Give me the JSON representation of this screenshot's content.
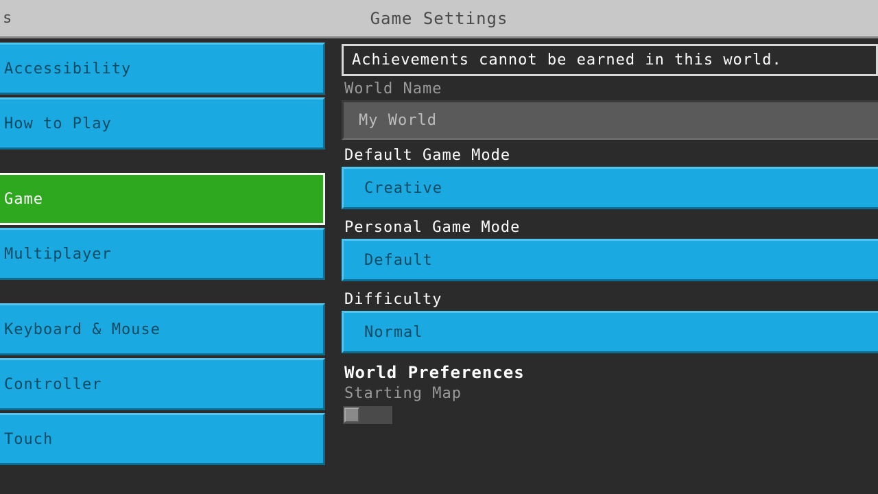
{
  "header": {
    "left_truncated": "s",
    "title": "Game Settings"
  },
  "sidebar": {
    "groups": [
      {
        "items": [
          {
            "label": "Accessibility",
            "active": false,
            "visible_text": "cessibility"
          },
          {
            "label": "How to Play",
            "active": false,
            "visible_text": "w to Play"
          }
        ]
      },
      {
        "items": [
          {
            "label": "Game",
            "active": true,
            "visible_text": "me"
          },
          {
            "label": "Multiplayer",
            "active": false,
            "visible_text": "ltiplayer"
          }
        ]
      },
      {
        "items": [
          {
            "label": "Keyboard & Mouse",
            "active": false,
            "visible_text": "yboard & Mouse"
          },
          {
            "label": "Controller",
            "active": false,
            "visible_text": "ntroller"
          },
          {
            "label": "Touch",
            "active": false,
            "visible_text": "uch"
          }
        ]
      }
    ]
  },
  "main": {
    "notice": "Achievements cannot be earned in this world.",
    "world_name_label": "World Name",
    "world_name_value": "My World",
    "default_game_mode_label": "Default Game Mode",
    "default_game_mode_value": "Creative",
    "personal_game_mode_label": "Personal Game Mode",
    "personal_game_mode_value": "Default",
    "difficulty_label": "Difficulty",
    "difficulty_value": "Normal",
    "world_preferences_title": "World Preferences",
    "starting_map_label": "Starting Map"
  }
}
